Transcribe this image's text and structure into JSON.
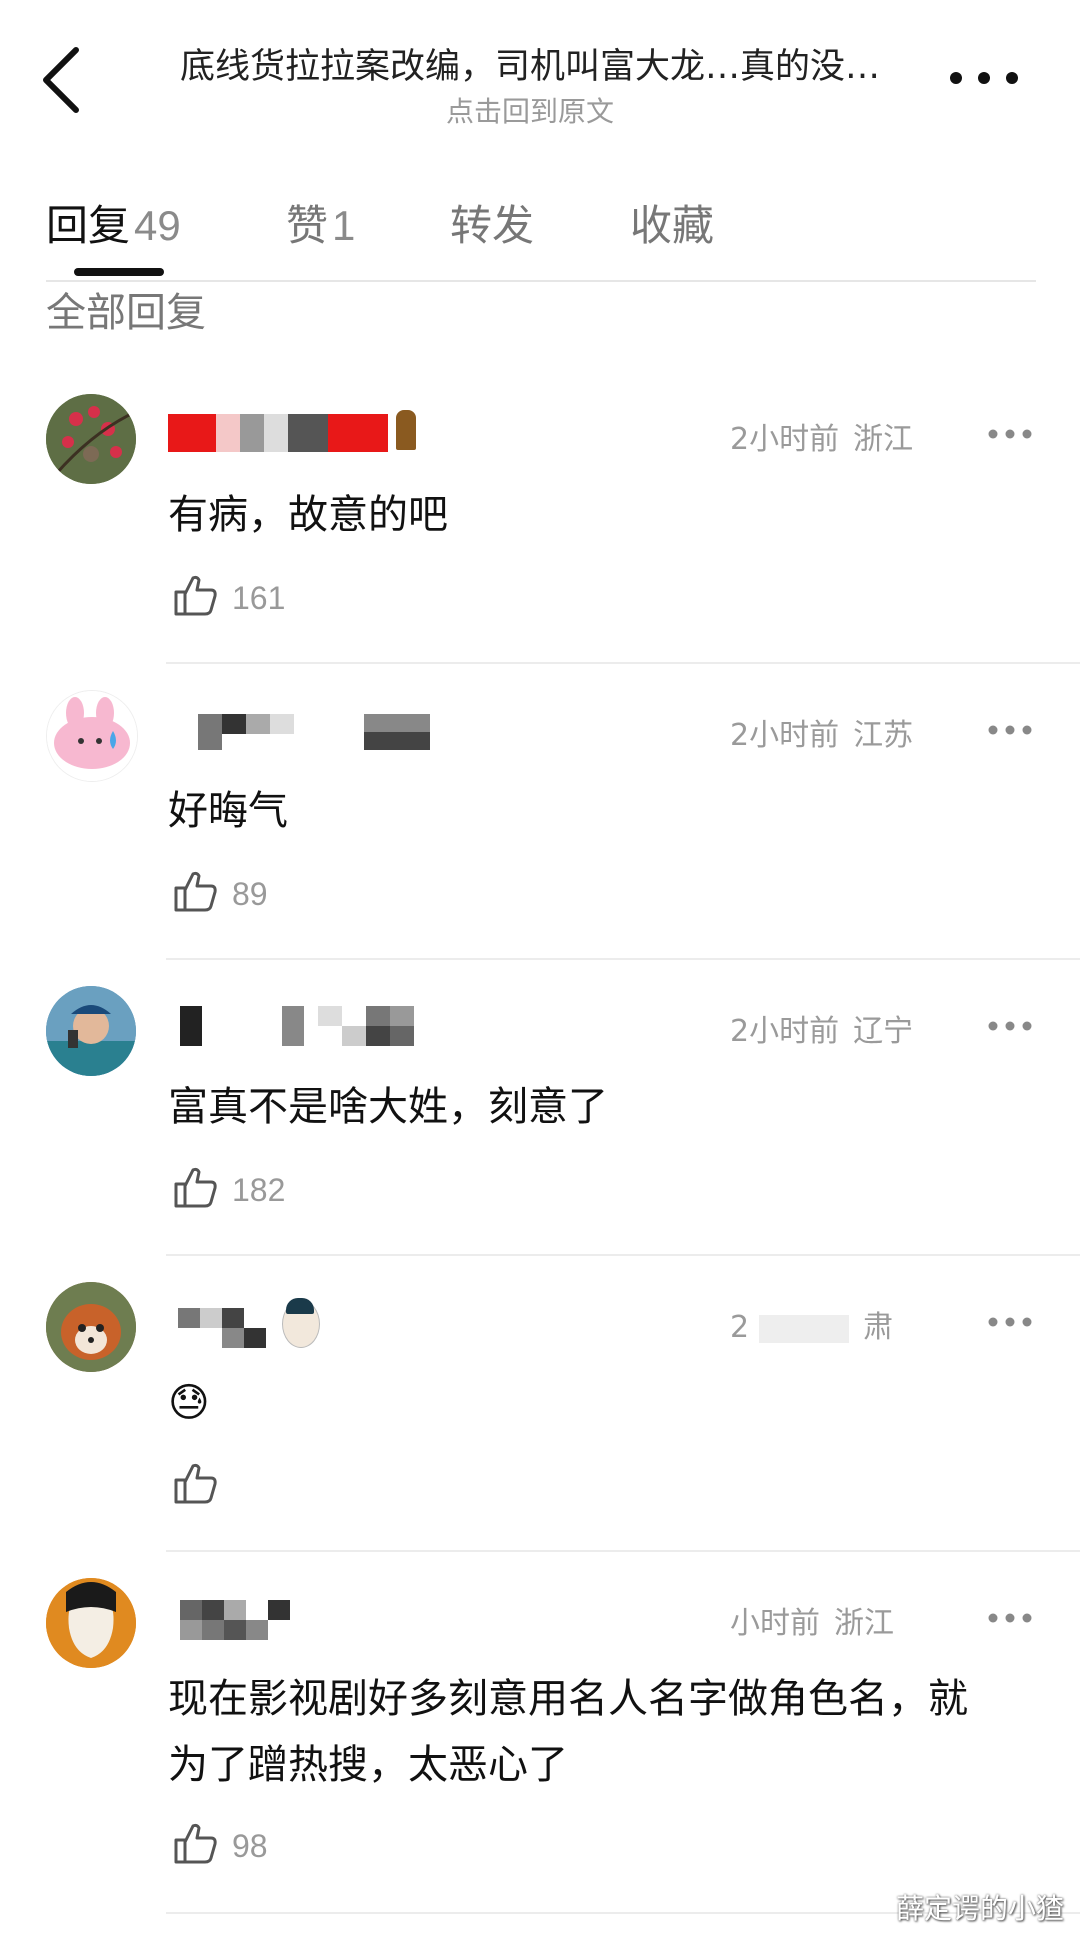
{
  "header": {
    "title": "底线货拉拉案改编，司机叫富大龙…真的没…",
    "subtitle": "点击回到原文"
  },
  "tabs": [
    {
      "label": "回复",
      "count": "49"
    },
    {
      "label": "赞",
      "count": "1"
    },
    {
      "label": "转发",
      "count": ""
    },
    {
      "label": "收藏",
      "count": ""
    }
  ],
  "section_title": "全部回复",
  "comments": [
    {
      "time": "2小时前",
      "region": "浙江",
      "text": "有病，故意的吧",
      "likes": "161"
    },
    {
      "time": "2小时前",
      "region": "江苏",
      "text": "好晦气",
      "likes": "89"
    },
    {
      "time": "2小时前",
      "region": "辽宁",
      "text": "富真不是啥大姓，刻意了",
      "likes": "182"
    },
    {
      "time": "2",
      "region": "肃",
      "text": "😓",
      "likes": ""
    },
    {
      "time": "小时前",
      "region": "浙江",
      "text": "现在影视剧好多刻意用名人名字做角色名，就为了蹭热搜，太恶心了",
      "likes": "98"
    }
  ],
  "watermark": "薛定谔的小猹",
  "colors": {
    "accent": "#111111",
    "muted": "#9a9a9a",
    "divider": "#ececec",
    "mosaic_red": "#e81818"
  },
  "icons": [
    "back-arrow-icon",
    "more-icon",
    "thumb-up-icon",
    "avatar-image"
  ]
}
